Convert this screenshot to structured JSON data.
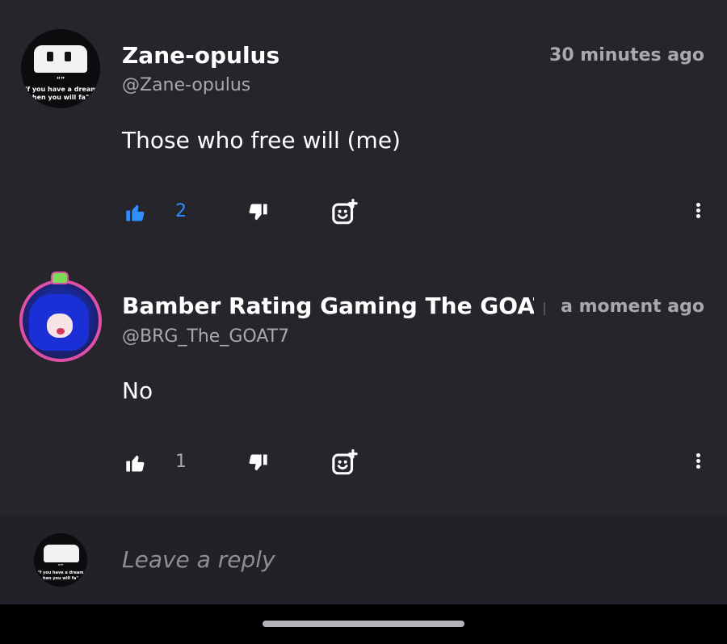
{
  "comments": [
    {
      "username": "Zane-opulus",
      "handle": "@Zane-opulus",
      "time": "30 minutes ago",
      "text": "Those who free will (me)",
      "likes": "2",
      "liked": true,
      "avatar_quote": [
        "“”",
        "\"f you have a dream",
        "hen you will fa\""
      ]
    },
    {
      "username": "Bamber Rating Gaming The GOAT",
      "handle": "@BRG_The_GOAT7",
      "time": "a moment ago",
      "text": "No",
      "likes": "1",
      "liked": false
    }
  ],
  "reply": {
    "placeholder": "Leave a reply",
    "avatar_quote": [
      "“”",
      "\"f you have a dream",
      "hen you will fa\""
    ]
  },
  "colors": {
    "background": "#26252c",
    "liked_accent": "#2f8fff",
    "muted_text": "#a9a8ae"
  },
  "icons": [
    "thumbs-up-icon",
    "thumbs-down-icon",
    "add-reaction-icon",
    "more-vertical-icon"
  ]
}
